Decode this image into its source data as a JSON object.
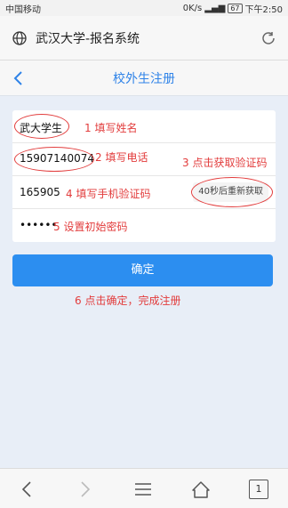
{
  "status": {
    "carrier": "中国移动",
    "speed": "0K/s",
    "battery": "67",
    "time": "下午2:50"
  },
  "browser": {
    "page_title": "武汉大学-报名系统",
    "icons": [
      "globe-icon",
      "reload-icon"
    ]
  },
  "header": {
    "title": "校外生注册"
  },
  "form": {
    "name_value": "武大学生",
    "name_note": "1 填写姓名",
    "phone_value": "15907140074",
    "phone_note": "2 填写电话",
    "code_step_note": "3 点击获取验证码",
    "code_value": "165905",
    "code_note": "4 填写手机验证码",
    "resend_label": "40秒后重新获取",
    "password_value": "••••••",
    "password_note": "5 设置初始密码"
  },
  "confirm": {
    "label": "确定",
    "note": "6 点击确定，完成注册"
  },
  "bottom_nav": {
    "tab_count": "1",
    "icons": [
      "back-icon",
      "forward-icon",
      "menu-icon",
      "home-icon",
      "tabs-icon"
    ]
  },
  "colors": {
    "accent": "#2c8ef0",
    "annotation": "#e23c3c",
    "content_bg": "#e8eef7"
  }
}
